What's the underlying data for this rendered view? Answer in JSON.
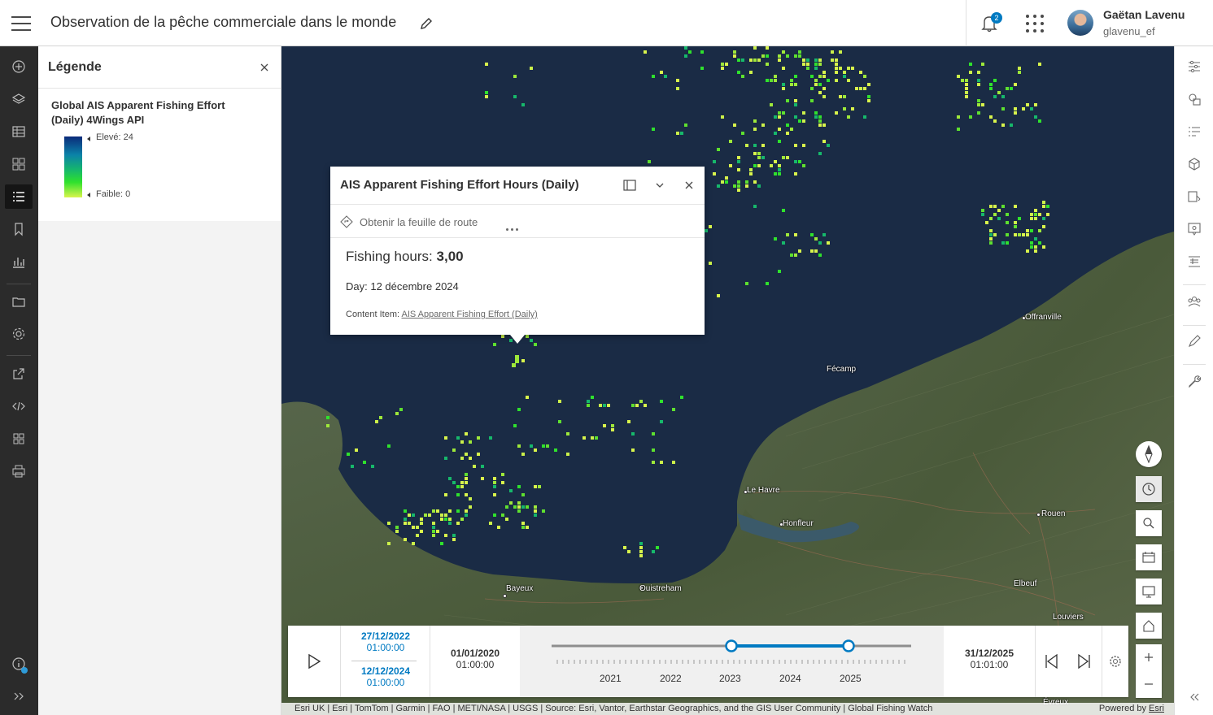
{
  "header": {
    "title": "Observation de la pêche commerciale dans le monde",
    "notification_count": "2",
    "user_name": "Gaëtan Lavenu",
    "user_id": "glavenu_ef"
  },
  "left_bar": {
    "items": [
      "add-icon",
      "layers-icon",
      "table-icon",
      "legend-grid-icon",
      "legend-icon",
      "bookmark-icon",
      "chart-icon",
      "folder-icon",
      "settings-icon",
      "share-icon",
      "embed-icon",
      "apps-icon",
      "print-icon",
      "info-icon",
      "expand-icon"
    ]
  },
  "legend": {
    "title": "Légende",
    "layer_name": "Global AIS Apparent Fishing Effort (Daily) 4Wings API",
    "high_label": "Elevé: 24",
    "low_label": "Faible: 0"
  },
  "map": {
    "cities": [
      "Offranville",
      "Fécamp",
      "Le Havre",
      "Honfleur",
      "Rouen",
      "Bayeux",
      "Ouistreham",
      "Elbeuf",
      "Louviers",
      "Évreux"
    ]
  },
  "popup": {
    "title": "AIS Apparent Fishing Effort Hours (Daily)",
    "directions_label": "Obtenir la feuille de route",
    "fishing_hours_label": "Fishing hours:",
    "fishing_hours_value": "3,00",
    "day_text": "Day: 12 décembre 2024",
    "content_item_label": "Content Item:",
    "content_item_link": "AIS Apparent Fishing Effort (Daily)"
  },
  "timeslider": {
    "range_start_date": "27/12/2022",
    "range_start_time": "01:00:00",
    "range_end_date": "12/12/2024",
    "range_end_time": "01:00:00",
    "min_date": "01/01/2020",
    "min_time": "01:00:00",
    "max_date": "31/12/2025",
    "max_time": "01:01:00",
    "years": [
      "2021",
      "2022",
      "2023",
      "2024",
      "2025"
    ]
  },
  "attribution": {
    "text": "Esri UK | Esri | TomTom | Garmin | FAO | METI/NASA | USGS | Source: Esri, Vantor, Earthstar Geographics, and the GIS User Community | Global Fishing Watch",
    "powered_by": "Powered by",
    "esri": "Esri"
  },
  "colors": {
    "accent": "#007ac2",
    "sea": "#1a2b45",
    "land": "#4a5a3a",
    "fishing_low": "#d8f44c",
    "fishing_mid": "#2fe12d",
    "fishing_high": "#0b2a7a"
  }
}
